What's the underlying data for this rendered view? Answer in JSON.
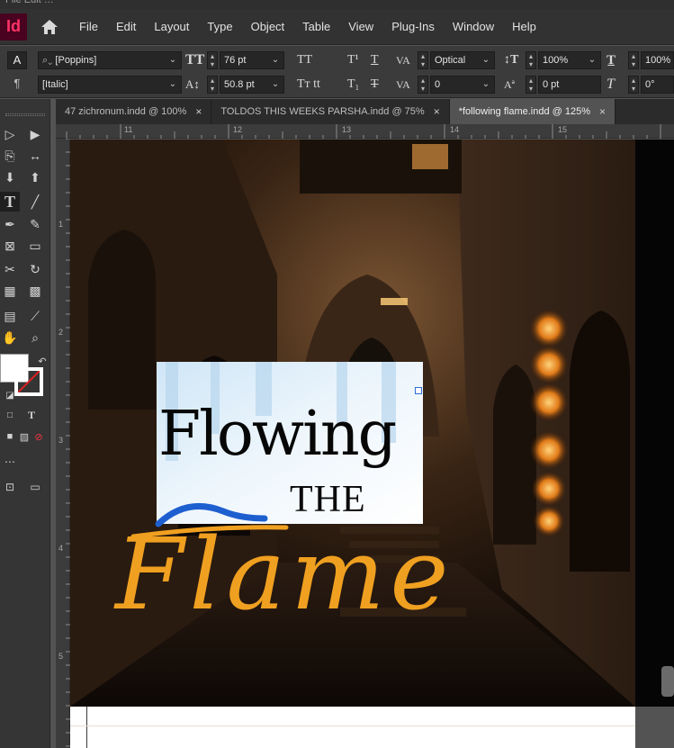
{
  "menubar": {
    "app_icon_label": "Id",
    "items": [
      "File",
      "Edit",
      "Layout",
      "Type",
      "Object",
      "Table",
      "View",
      "Plug-Ins",
      "Window",
      "Help"
    ]
  },
  "control_panel": {
    "font_family": "[Poppins]",
    "font_style": "[Italic]",
    "font_size": "76 pt",
    "leading": "50.8 pt",
    "kerning": "Optical",
    "tracking": "0",
    "vertical_scale": "100%",
    "horizontal_scale": "100%",
    "baseline_shift": "0 pt",
    "skew": "0°",
    "char_mode_label": "A",
    "para_mode_label": "¶"
  },
  "tabs": [
    {
      "label": "47 zichronum.indd @ 100%",
      "active": false
    },
    {
      "label": "TOLDOS THIS WEEKS PARSHA.indd @ 75%",
      "active": false
    },
    {
      "label": "*following flame.indd @ 125%",
      "active": true
    }
  ],
  "tab_close_glyph": "×",
  "rulers": {
    "top": [
      "11",
      "12",
      "13",
      "14",
      "15"
    ],
    "left": [
      "1",
      "2",
      "3",
      "4",
      "5"
    ]
  },
  "artwork": {
    "title_line1": "Flowing",
    "title_line2": "THE",
    "title_line3": "Flame",
    "flame_color": "#f0a020",
    "accent_color": "#1e5fd0"
  },
  "colors": {
    "app_accent": "#ff3366"
  }
}
